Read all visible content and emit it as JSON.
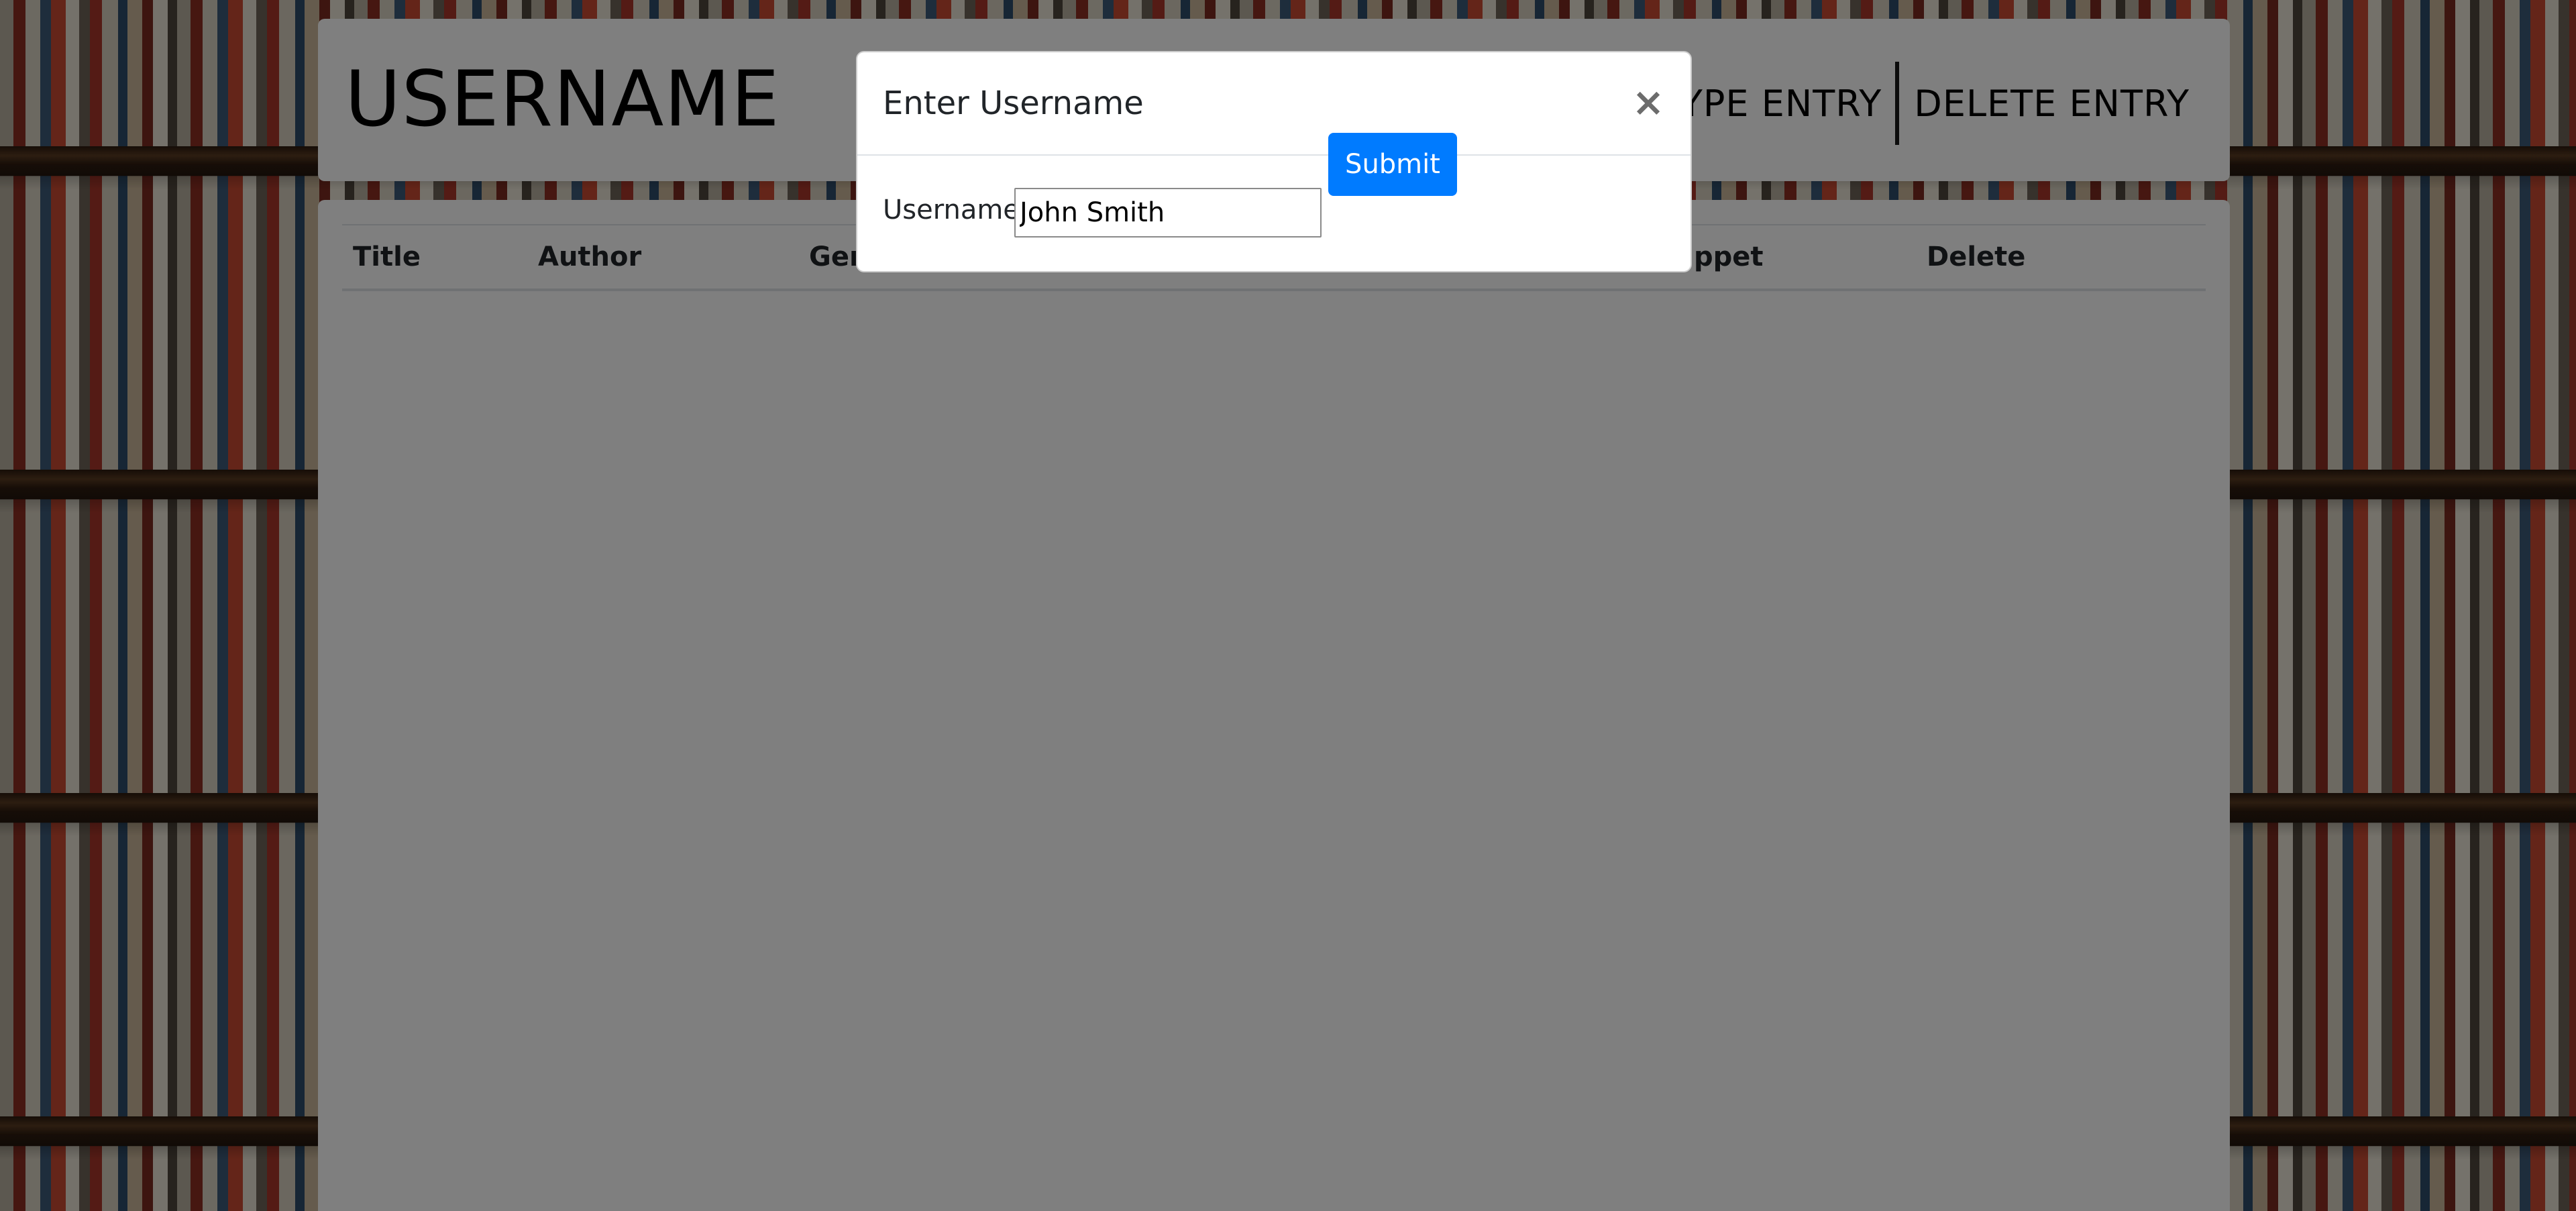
{
  "header": {
    "title": "USERNAME",
    "nav": [
      {
        "label": "TYPE ENTRY"
      },
      {
        "label": "DELETE ENTRY"
      }
    ]
  },
  "table": {
    "columns": [
      "Title",
      "Author",
      "Genre",
      "Snippet",
      "Delete"
    ]
  },
  "modal": {
    "title": "Enter Username",
    "close_symbol": "×",
    "username_label": "Username:",
    "username_value": "John Smith",
    "submit_label": "Submit"
  },
  "colors": {
    "submit_button": "#007bff",
    "backdrop": "rgba(0,0,0,0.5)",
    "panel": "#ffffff"
  }
}
